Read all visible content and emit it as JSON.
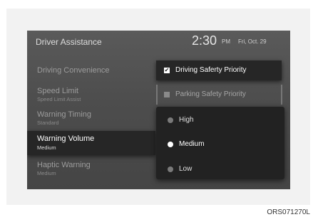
{
  "header": {
    "title": "Driver Assistance",
    "time": "2:30",
    "ampm": "PM",
    "date": "Fri, Oct. 29"
  },
  "menu": {
    "items": [
      {
        "label": "Driving Convenience",
        "sub": ""
      },
      {
        "label": "Speed Limit",
        "sub": "Speed Limit Assist"
      },
      {
        "label": "Warning Timing",
        "sub": "Standard"
      },
      {
        "label": "Warning Volume",
        "sub": "Medium",
        "selected": true
      },
      {
        "label": "Haptic Warning",
        "sub": "Medium"
      }
    ]
  },
  "options": [
    {
      "label": "Driving Saferty Priority",
      "checked": true
    },
    {
      "label": "Parking Safety Priority",
      "checked": false
    }
  ],
  "popup": {
    "choices": [
      {
        "label": "High",
        "selected": false
      },
      {
        "label": "Medium",
        "selected": true
      },
      {
        "label": "Low",
        "selected": false
      }
    ]
  },
  "caption": "ORS071270L"
}
